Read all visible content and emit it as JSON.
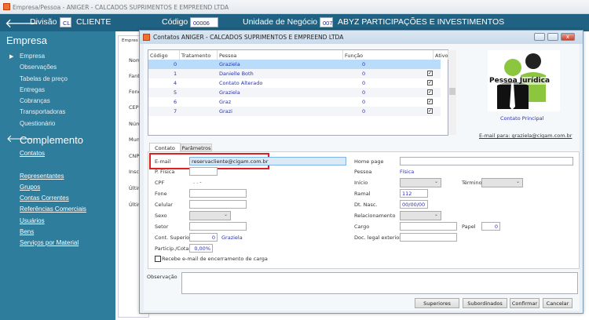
{
  "window": {
    "title": "Empresa/Pessoa - ANIGER - CALCADOS SUPRIMENTOS E EMPREEND LTDA"
  },
  "header": {
    "divisao_label": "Divisão",
    "divisao_code": "CL",
    "divisao_name": "CLIENTE",
    "codigo_label": "Código",
    "codigo_value": "00006",
    "unidade_label": "Unidade de Negócio",
    "unidade_code": "007",
    "unidade_name": "ABYZ PARTICIPAÇÕES E INVESTIMENTOS"
  },
  "sidebar": {
    "empresa_title": "Empresa",
    "empresa_items": [
      "Empresa",
      "Observações",
      "Tabelas de preço",
      "Entregas",
      "Cobranças",
      "Transportadoras",
      "Questionário"
    ],
    "complemento_title": "Complemento",
    "complemento_links": [
      "Contatos",
      "Representantes",
      "Grupos",
      "Contas Correntes",
      "Referências Comerciais",
      "Usuários",
      "Bens",
      "Serviços por Material"
    ]
  },
  "background_panel": {
    "tab": "Empres",
    "labels": [
      "Nom",
      "Fant",
      "Fone",
      "CEP",
      "Núm",
      "Muni",
      "CNP",
      "Insc",
      "Últim",
      "Últim"
    ]
  },
  "dialog": {
    "title": "Contatos ANIGER - CALCADOS SUPRIMENTOS E EMPREEND LTDA",
    "grid": {
      "columns": [
        "Código",
        "Tratamento",
        "Pessoa",
        "Função",
        "Ativo"
      ],
      "rows": [
        {
          "codigo": "0",
          "pessoa": "Graziela",
          "funcao": "0",
          "ativo": false,
          "selected": true
        },
        {
          "codigo": "1",
          "pessoa": "Danielle Both",
          "funcao": "0",
          "ativo": true
        },
        {
          "codigo": "4",
          "pessoa": "Contato Alterado",
          "funcao": "0",
          "ativo": true
        },
        {
          "codigo": "5",
          "pessoa": "Graziela",
          "funcao": "0",
          "ativo": true
        },
        {
          "codigo": "6",
          "pessoa": "Graz",
          "funcao": "0",
          "ativo": true
        },
        {
          "codigo": "7",
          "pessoa": "Grazi",
          "funcao": "0",
          "ativo": true
        }
      ]
    },
    "image_text": "Pessoa Jurídica",
    "contato_principal": "Contato Principal",
    "email_link": "E-mail para: graziela@cigam.com.br",
    "tabs": [
      "Contato",
      "Parâmetros"
    ],
    "form": {
      "email_label": "E-mail",
      "email_value": "reservacliente@cigam.com.br",
      "pfisica_label": "P. Física",
      "cpf_label": "CPF",
      "cpf_value": ". . -",
      "fone_label": "Fone",
      "celular_label": "Celular",
      "sexo_label": "Sexo",
      "setor_label": "Setor",
      "cont_superior_label": "Cont. Superior",
      "cont_superior_value": "0",
      "cont_superior_name": "Graziela",
      "particip_label": "Particip./Cotas",
      "particip_value": "0,00%",
      "recebe_label": "Recebe e-mail de encerramento de carga",
      "homepage_label": "Home page",
      "pessoa_label": "Pessoa",
      "pessoa_value": "Física",
      "inicio_label": "Início",
      "termino_label": "Término",
      "ramal_label": "Ramal",
      "ramal_value": "112",
      "dtnasc_label": "Dt. Nasc.",
      "dtnasc_value": "00/00/00",
      "relacionamento_label": "Relacionamento",
      "cargo_label": "Cargo",
      "papel_label": "Papel",
      "papel_value": "0",
      "doc_label": "Doc. legal exterior",
      "observacao_label": "Observação"
    },
    "buttons": {
      "superiores": "Superiores",
      "subordinados": "Subordinados",
      "confirmar": "Confirmar",
      "cancelar": "Cancelar"
    },
    "highlight_color": "#e02020"
  }
}
